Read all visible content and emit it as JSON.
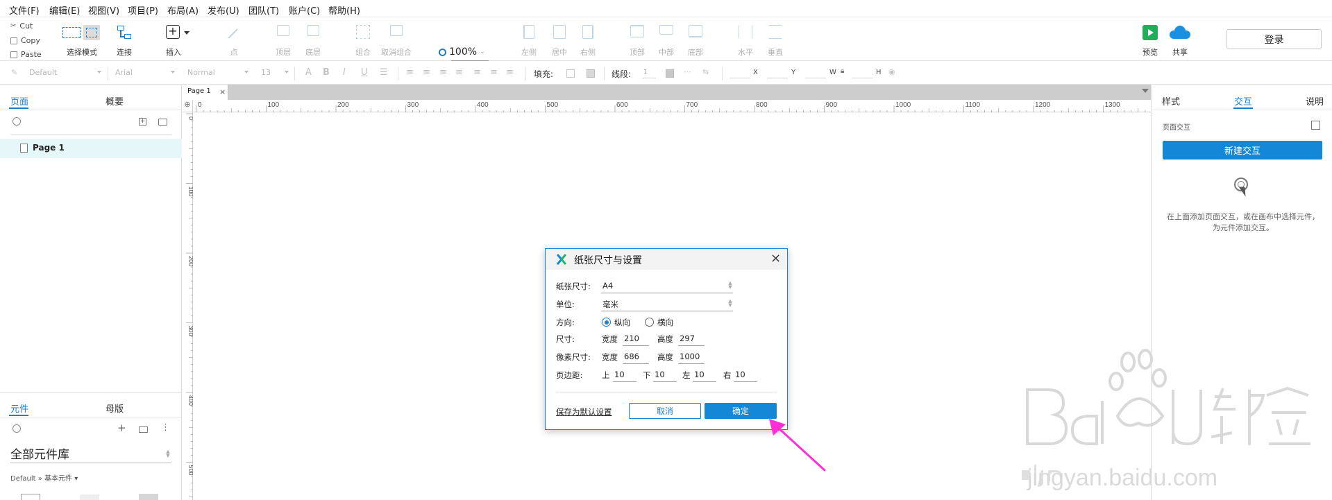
{
  "menu": [
    "文件(F)",
    "编辑(E)",
    "视图(V)",
    "项目(P)",
    "布局(A)",
    "发布(U)",
    "团队(T)",
    "账户(C)",
    "帮助(H)"
  ],
  "clipboard": {
    "cut": "Cut",
    "copy": "Copy",
    "paste": "Paste"
  },
  "toolbar": {
    "select_mode": "选择模式",
    "connect": "连接",
    "insert": "插入",
    "point": "点",
    "top_layer": "顶层",
    "bottom_layer": "底层",
    "group": "组合",
    "ungroup": "取消组合",
    "zoom": "100%",
    "align_left": "左侧",
    "align_center": "居中",
    "align_right": "右侧",
    "align_top": "顶部",
    "align_middle": "中部",
    "align_bottom": "底部",
    "distribute_h": "水平",
    "distribute_v": "垂直",
    "preview": "预览",
    "share": "共享",
    "login": "登录"
  },
  "format": {
    "style": "Default",
    "font": "Arial",
    "weight": "Normal",
    "size": "13",
    "fill_label": "填充:",
    "line_label": "线段:",
    "line_value": "1",
    "x_label": "X",
    "y_label": "Y",
    "w_label": "W",
    "h_label": "H"
  },
  "left": {
    "tab_pages": "页面",
    "tab_outline": "概要",
    "page_item": "Page 1",
    "tab_widgets": "元件",
    "tab_masters": "母版",
    "library": "全部元件库",
    "library_sub": "Default » 基本元件 ▾"
  },
  "canvas": {
    "tab": "Page 1",
    "tab_close": "×",
    "ruler_top": [
      "0",
      "100",
      "200",
      "300",
      "400",
      "500",
      "600",
      "700",
      "800",
      "900",
      "1000",
      "1100",
      "1200",
      "1300"
    ],
    "ruler_left": [
      "0",
      "100",
      "200",
      "300",
      "400",
      "500"
    ]
  },
  "right": {
    "tab_style": "样式",
    "tab_interaction": "交互",
    "tab_notes": "说明",
    "page_interaction": "页面交互",
    "new_interaction": "新建交互",
    "hint": "在上面添加页面交互，或在画布中选择元件，为元件添加交互。"
  },
  "dialog": {
    "title": "纸张尺寸与设置",
    "paper_size_label": "纸张尺寸:",
    "paper_size": "A4",
    "unit_label": "单位:",
    "unit": "毫米",
    "orientation_label": "方向:",
    "portrait": "纵向",
    "landscape": "横向",
    "size_label": "尺寸:",
    "width_label": "宽度",
    "height_label": "高度",
    "size_width": "210",
    "size_height": "297",
    "pixel_label": "像素尺寸:",
    "pixel_width": "686",
    "pixel_height": "1000",
    "margin_label": "页边距:",
    "top_label": "上",
    "bottom_label": "下",
    "left_label": "左",
    "right_label": "右",
    "margin_top": "10",
    "margin_bottom": "10",
    "margin_left": "10",
    "margin_right": "10",
    "save_default": "保存为默认设置",
    "cancel": "取消",
    "ok": "确定"
  },
  "colors": {
    "accent": "#1487d6",
    "arrow": "#ff2fd6",
    "selected_row": "#e6f7fa"
  }
}
